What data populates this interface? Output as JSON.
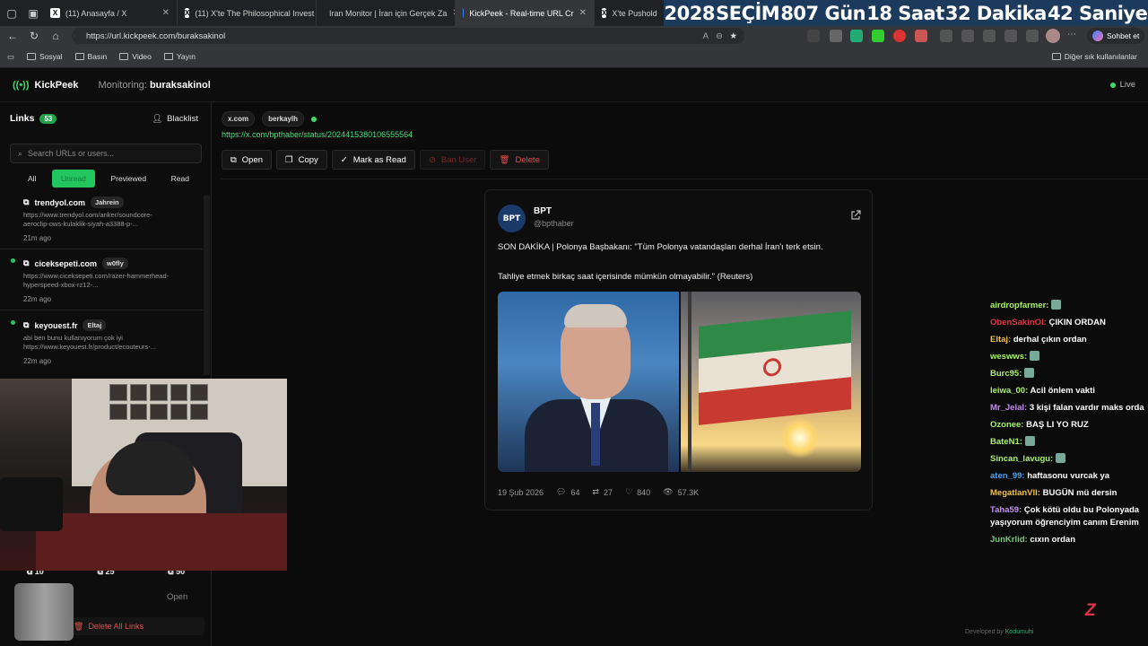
{
  "tabs": [
    {
      "label": "(11) Anasayfa / X",
      "fav": "X",
      "fav_color": "#000000"
    },
    {
      "label": "(11) X'te The Philosophical Invest",
      "fav": "X",
      "fav_color": "#000000"
    },
    {
      "label": "Iran Monitor | İran için Gerçek Za",
      "fav": "",
      "fav_color": "#b02020"
    },
    {
      "label": "KickPeek - Real-time URL Cr",
      "fav": "",
      "fav_color": "#3b7cff"
    },
    {
      "label": "X'te Pusholde",
      "fav": "X",
      "fav_color": "#000000"
    }
  ],
  "countdown": {
    "year": "2028",
    "label": "SEÇİM",
    "days": "807 Gün",
    "hours": "18 Saat",
    "minutes": "32 Dakika",
    "seconds": "42 Saniye"
  },
  "browser": {
    "url": "https://url.kickpeek.com/buraksakinol",
    "chat_button": "Sohbet et"
  },
  "bookmarks": [
    "Sosyal",
    "Basın",
    "Video",
    "Yayın"
  ],
  "bookmarks_other": "Diğer sık kullanılanlar",
  "app": {
    "name": "KickPeek",
    "monitoring_label": "Monitoring:",
    "monitoring_user": "buraksakinol",
    "live": "Live"
  },
  "sidebar": {
    "title": "Links",
    "count": "53",
    "blacklist": "Blacklist",
    "search_placeholder": "Search URLs or users...",
    "filters": [
      "All",
      "Unread",
      "Previewed",
      "Read"
    ],
    "items": [
      {
        "domain": "trendyol.com",
        "user": "Jahrein",
        "url": "https://www.trendyol.com/anker/soundcore-aeroclip-ows-kulaklik-siyah-a3388-p-...",
        "time": "21m ago"
      },
      {
        "domain": "ciceksepeti.com",
        "user": "w0fly",
        "url": "https://www.ciceksepeti.com/razer-hammerhead-hyperspeed-xbox-rz12-...",
        "time": "22m ago"
      },
      {
        "domain": "keyouest.fr",
        "user": "Eltaj",
        "url": "abi ben bunu kullanıyorum çok iyi https://www.keyouest.fr/product/ecouteurs-...",
        "time": "22m ago"
      }
    ],
    "stats": [
      "10",
      "25",
      "50"
    ],
    "open": "Open",
    "delete_all": "Delete All Links"
  },
  "main": {
    "chips": [
      "x.com",
      "berkaylh"
    ],
    "url": "https://x.com/bpthaber/status/2024415380106555564",
    "actions": {
      "open": "Open",
      "copy": "Copy",
      "mark": "Mark as Read",
      "ban": "Ban User",
      "delete": "Delete"
    }
  },
  "post": {
    "avatar": "BPT",
    "name": "BPT",
    "handle": "@bpthaber",
    "text1": "SON DAKİKA | Polonya Başbakanı: \"Tüm Polonya vatandaşları derhal İran'ı terk etsin.",
    "text2": "Tahliye etmek birkaç saat içerisinde mümkün olmayabilir.\" (Reuters)",
    "date": "19 Şub 2026",
    "replies": "64",
    "retweets": "27",
    "likes": "840",
    "views": "57.3K"
  },
  "chat": [
    {
      "user": "airdropfarmer:",
      "color": "#a9f06a",
      "text": ""
    },
    {
      "user": "ObenSakinOl:",
      "color": "#e03545",
      "text": "ÇIKIN ORDAN"
    },
    {
      "user": "Eltaj:",
      "color": "#f0c040",
      "text": "derhal çıkın ordan"
    },
    {
      "user": "weswws:",
      "color": "#a9f06a",
      "text": ""
    },
    {
      "user": "Burc95:",
      "color": "#a9f06a",
      "text": ""
    },
    {
      "user": "leiwa_00:",
      "color": "#a9f06a",
      "text": "Acil önlem vakti"
    },
    {
      "user": "Mr_Jelal:",
      "color": "#c68cf0",
      "text": "3 kişi falan vardır maks orda"
    },
    {
      "user": "Ozonee:",
      "color": "#a9f06a",
      "text": "BAŞ LI YO RUZ"
    },
    {
      "user": "BateN1:",
      "color": "#a9f06a",
      "text": ""
    },
    {
      "user": "Sincan_lavugu:",
      "color": "#a9f06a",
      "text": ""
    },
    {
      "user": "aten_99:",
      "color": "#4aa0f0",
      "text": "haftasonu vurcak ya"
    },
    {
      "user": "MegatlanVII:",
      "color": "#f0c040",
      "text": "BUGÜN mü dersin"
    },
    {
      "user": "Taha59:",
      "color": "#c68cf0",
      "text": "Çok kötü oldu bu Polonyada yaşıyorum öğrenciyim canım Erenim"
    },
    {
      "user": "JunKrlid:",
      "color": "#7fc77f",
      "text": "cıxın ordan"
    }
  ],
  "footer": {
    "devby": "Developed by",
    "dev": "Kodumuhi"
  }
}
